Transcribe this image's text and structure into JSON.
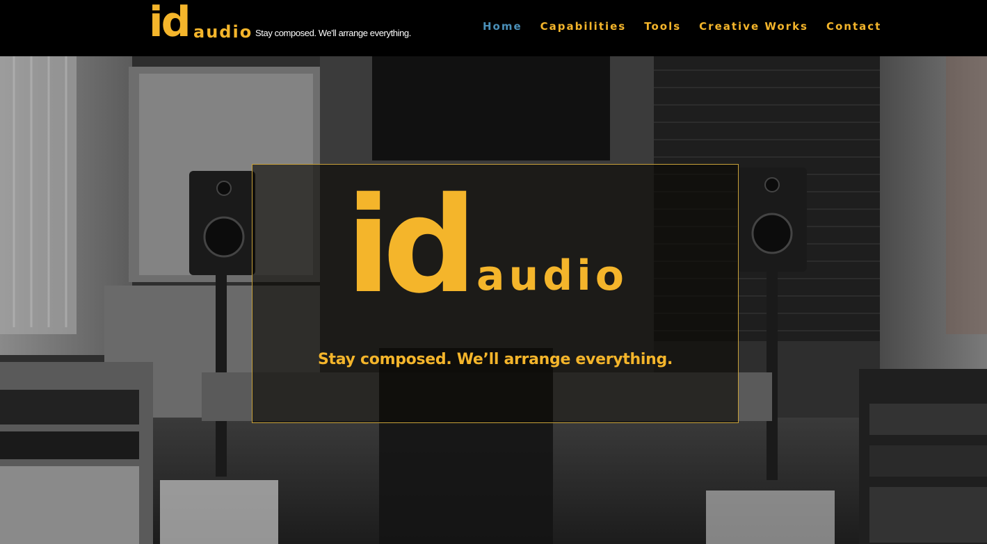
{
  "header": {
    "logo": {
      "id_text": "id",
      "audio_text": "audio",
      "tagline": "Stay composed. We'll arrange everything."
    },
    "nav": [
      {
        "label": "Home",
        "active": true
      },
      {
        "label": "Capabilities",
        "active": false
      },
      {
        "label": "Tools",
        "active": false
      },
      {
        "label": "Creative Works",
        "active": false
      },
      {
        "label": "Contact",
        "active": false
      }
    ]
  },
  "hero": {
    "logo": {
      "id_text": "id",
      "audio_text": "audio"
    },
    "tagline": "Stay composed. We’ll arrange everything."
  },
  "colors": {
    "brand_gold": "#f4b52b",
    "nav_active": "#4a8fb8",
    "header_bg": "#000000"
  }
}
